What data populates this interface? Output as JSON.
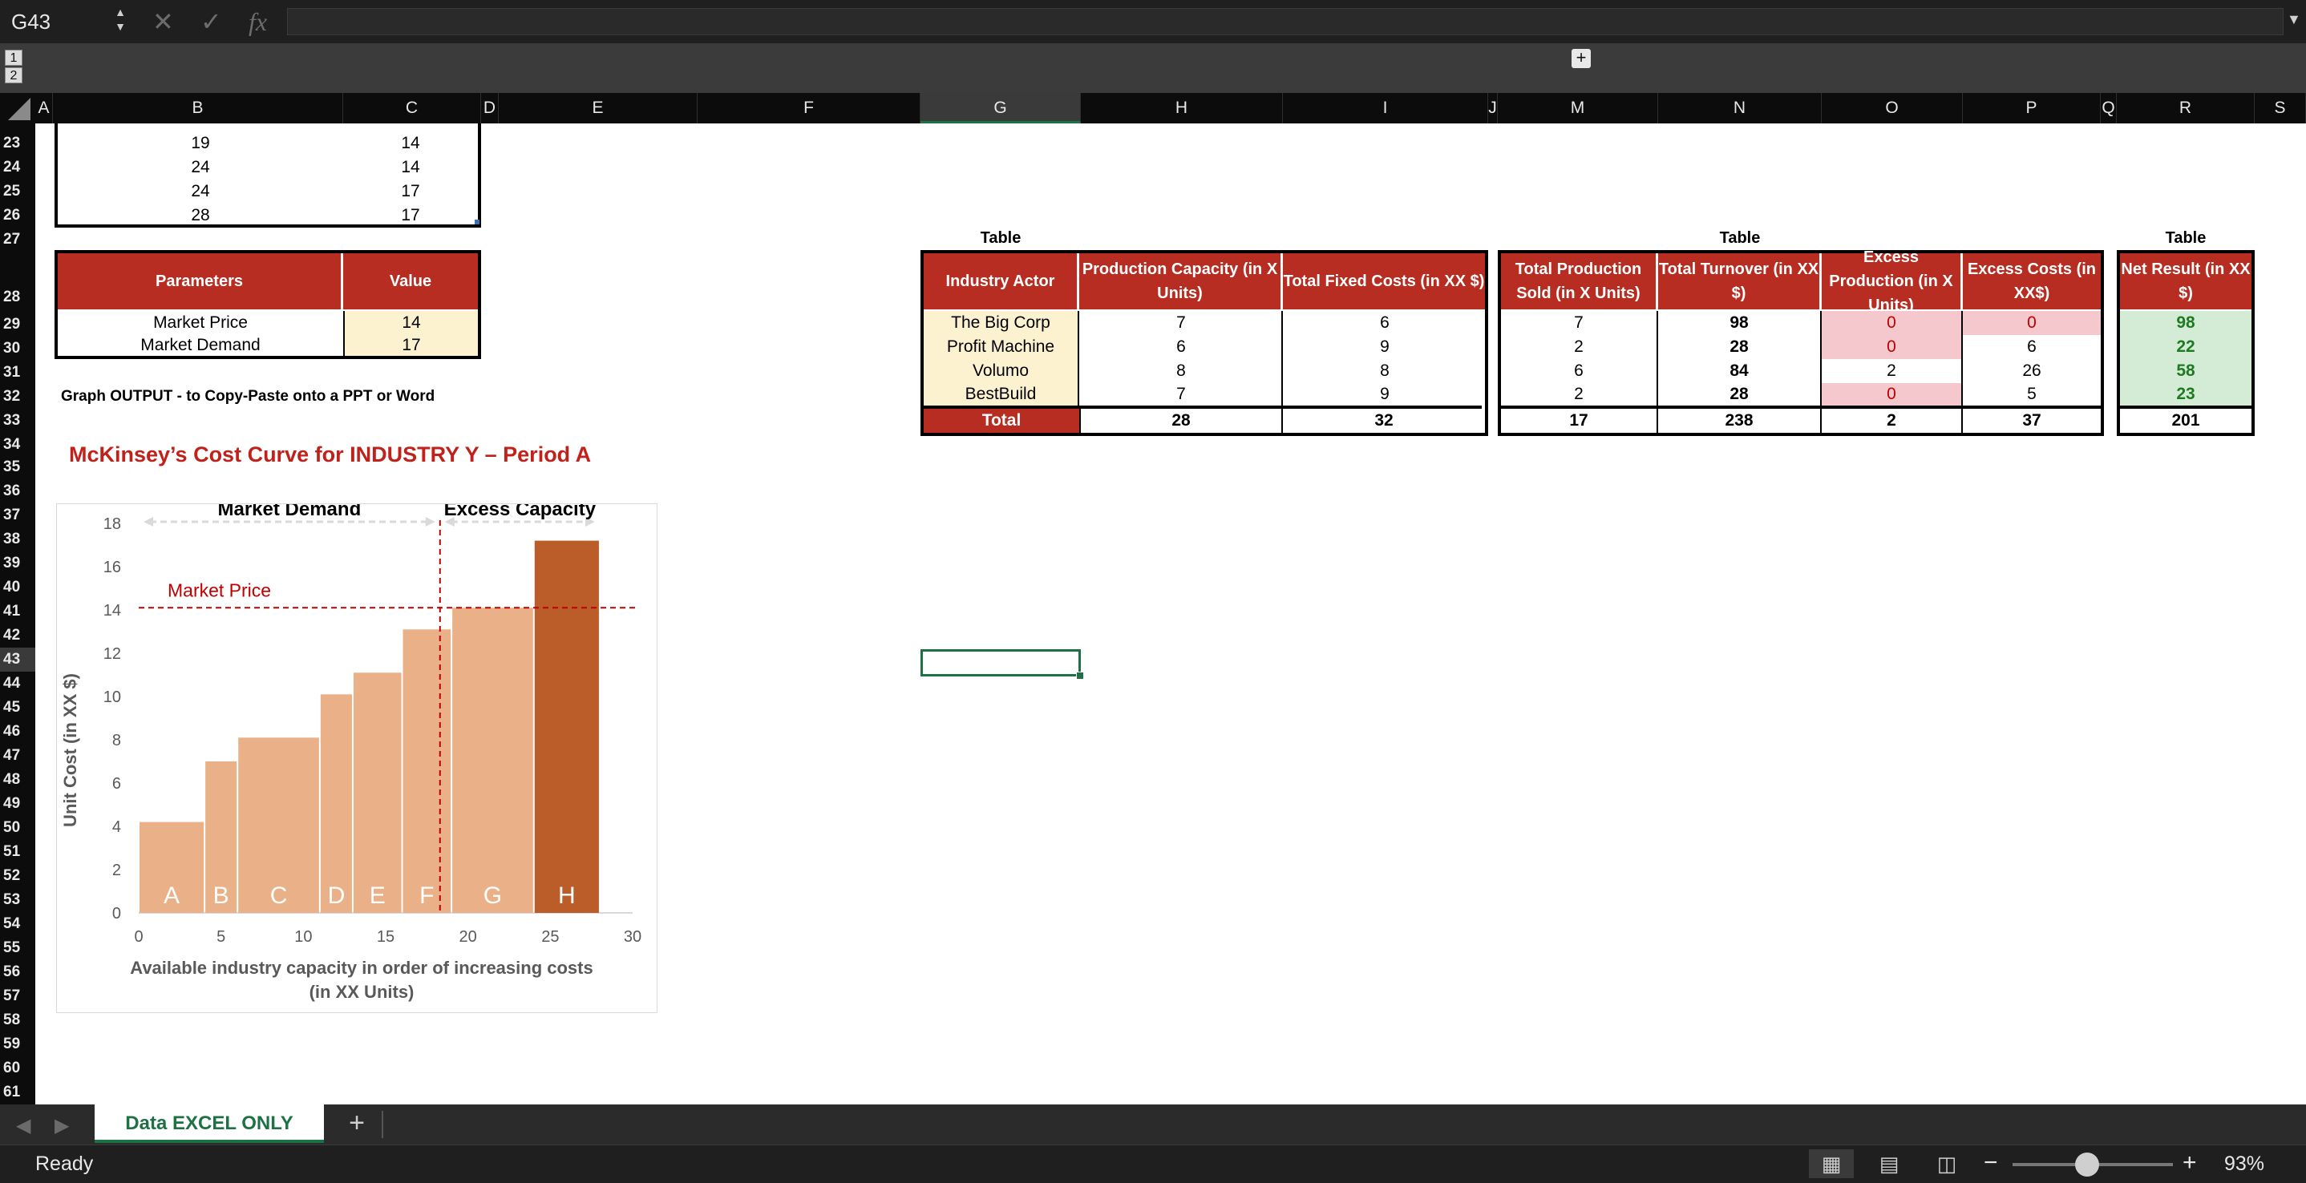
{
  "formula_bar": {
    "name_box": "G43",
    "fx": "fx",
    "formula": ""
  },
  "outline": {
    "level_1": "1",
    "level_2": "2",
    "expand": "+"
  },
  "columns": [
    "A",
    "B",
    "C",
    "D",
    "E",
    "F",
    "G",
    "H",
    "I",
    "J",
    "M",
    "N",
    "O",
    "P",
    "Q",
    "R",
    "S"
  ],
  "selected_column": "G",
  "rows": [
    "23",
    "24",
    "25",
    "26",
    "27",
    "28",
    "29",
    "30",
    "31",
    "32",
    "33",
    "34",
    "35",
    "36",
    "37",
    "38",
    "39",
    "40",
    "41",
    "42",
    "43",
    "44",
    "45",
    "46",
    "47",
    "48",
    "49",
    "50",
    "51",
    "52",
    "53",
    "54",
    "55",
    "56",
    "57",
    "58",
    "59",
    "60",
    "61"
  ],
  "selected_row": "43",
  "top_data": [
    [
      "19",
      "14"
    ],
    [
      "24",
      "14"
    ],
    [
      "24",
      "17"
    ],
    [
      "28",
      "17"
    ]
  ],
  "parameters": {
    "header_name": "Parameters",
    "header_value": "Value",
    "rows": [
      [
        "Market Price",
        "14"
      ],
      [
        "Market Demand",
        "17"
      ]
    ]
  },
  "graph_output_label": "Graph OUTPUT - to Copy-Paste onto a PPT or Word",
  "chart_title": "McKinsey’s Cost Curve for INDUSTRY Y – Period A",
  "table_labels": [
    "Table",
    "Table",
    "Table"
  ],
  "actor_table": {
    "headers": [
      "Industry Actor",
      "Production Capacity (in X Units)",
      "Total Fixed Costs (in XX $)"
    ],
    "rows": [
      [
        "The Big Corp",
        "7",
        "6"
      ],
      [
        "Profit Machine",
        "6",
        "9"
      ],
      [
        "Volumo",
        "8",
        "8"
      ],
      [
        "BestBuild",
        "7",
        "9"
      ]
    ],
    "total": [
      "Total",
      "28",
      "32"
    ]
  },
  "result_table": {
    "headers": [
      "Total Production Sold (in X Units)",
      "Total Turnover (in XX $)",
      "Excess Production (in X Units)",
      "Excess Costs (in XX$)"
    ],
    "rows": [
      [
        "7",
        "98",
        "0",
        "0"
      ],
      [
        "2",
        "28",
        "0",
        "6"
      ],
      [
        "6",
        "84",
        "2",
        "26"
      ],
      [
        "2",
        "28",
        "0",
        "5"
      ]
    ],
    "total": [
      "17",
      "238",
      "2",
      "37"
    ]
  },
  "net_table": {
    "header": "Net Result (in XX $)",
    "rows": [
      "98",
      "22",
      "58",
      "23"
    ],
    "total": "201"
  },
  "chart_data": {
    "type": "bar",
    "title": "",
    "xlabel": "Available industry capacity in order of increasing costs (in XX Units)",
    "ylabel": "Unit Cost (in XX $)",
    "xlim": [
      0,
      30
    ],
    "ylim": [
      0,
      18
    ],
    "xticks": [
      "0",
      "5",
      "10",
      "15",
      "20",
      "25",
      "30"
    ],
    "yticks": [
      "0",
      "2",
      "4",
      "6",
      "8",
      "10",
      "12",
      "14",
      "16",
      "18"
    ],
    "bars": [
      {
        "label": "A",
        "x0": 0,
        "x1": 4,
        "value": 4.2,
        "color": "#eab188"
      },
      {
        "label": "B",
        "x0": 4,
        "x1": 6,
        "value": 7,
        "color": "#eab188"
      },
      {
        "label": "C",
        "x0": 6,
        "x1": 11,
        "value": 8.1,
        "color": "#eab188"
      },
      {
        "label": "D",
        "x0": 11,
        "x1": 13,
        "value": 10.1,
        "color": "#eab188"
      },
      {
        "label": "E",
        "x0": 13,
        "x1": 16,
        "value": 11.1,
        "color": "#eab188"
      },
      {
        "label": "F",
        "x0": 16,
        "x1": 19,
        "value": 13.1,
        "color": "#eab188"
      },
      {
        "label": "G",
        "x0": 19,
        "x1": 24,
        "value": 14.1,
        "color": "#eab188"
      },
      {
        "label": "H",
        "x0": 24,
        "x1": 28,
        "value": 17.2,
        "color": "#bb5d29"
      }
    ],
    "market_price": {
      "label": "Market Price",
      "value": 14.1
    },
    "market_demand": {
      "label": "Market Demand",
      "value": 18.3
    },
    "excess_capacity": {
      "label": "Excess Capacity"
    },
    "colors": {
      "price_line": "#c00000",
      "axis_text": "#595959",
      "arrow": "#d9d9d9"
    }
  },
  "sheet_tabs": {
    "active": "Data EXCEL ONLY",
    "add": "+"
  },
  "status": {
    "text": "Ready",
    "zoom": "93%",
    "zoom_minus": "−",
    "zoom_plus": "+"
  }
}
